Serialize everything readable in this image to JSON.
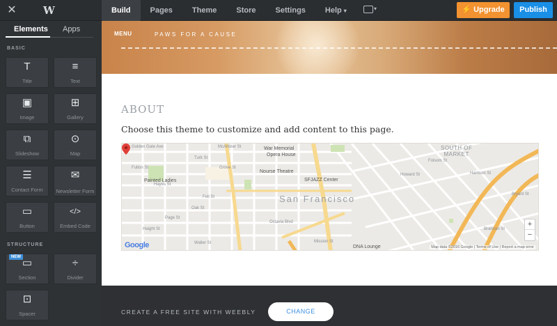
{
  "topbar": {
    "close_icon": "close-icon",
    "logo_icon": "W",
    "nav": [
      {
        "label": "Build",
        "active": true
      },
      {
        "label": "Pages"
      },
      {
        "label": "Theme"
      },
      {
        "label": "Store"
      },
      {
        "label": "Settings"
      },
      {
        "label": "Help",
        "dropdown": true
      }
    ],
    "upgrade_label": "Upgrade",
    "publish_label": "Publish",
    "colors": {
      "upgrade": "#f39230",
      "publish": "#1a8fe6"
    }
  },
  "sidebar": {
    "tabs": [
      {
        "label": "Elements",
        "active": true
      },
      {
        "label": "Apps"
      }
    ],
    "basic_label": "BASIC",
    "structure_label": "STRUCTURE",
    "basic_items": [
      {
        "label": "Title",
        "icon": "T",
        "icon_name": "title-icon"
      },
      {
        "label": "Text",
        "icon": "≡",
        "icon_name": "text-icon"
      },
      {
        "label": "Image",
        "icon": "▣",
        "icon_name": "image-icon"
      },
      {
        "label": "Gallery",
        "icon": "⊞",
        "icon_name": "gallery-icon"
      },
      {
        "label": "Slideshow",
        "icon": "⧉",
        "icon_name": "slideshow-icon"
      },
      {
        "label": "Map",
        "icon": "⊙",
        "icon_name": "map-pin-icon"
      },
      {
        "label": "Contact Form",
        "icon": "☰",
        "icon_name": "contact-form-icon"
      },
      {
        "label": "Newsletter Form",
        "icon": "✉",
        "icon_name": "envelope-icon"
      },
      {
        "label": "Button",
        "icon": "▭",
        "icon_name": "button-icon"
      },
      {
        "label": "Embed Code",
        "icon": "</>",
        "icon_name": "code-icon"
      }
    ],
    "structure_items": [
      {
        "label": "Section",
        "icon": "▭",
        "icon_name": "section-icon",
        "badge": "NEW"
      },
      {
        "label": "Divider",
        "icon": "÷",
        "icon_name": "divider-icon"
      },
      {
        "label": "Spacer",
        "icon": "⊡",
        "icon_name": "spacer-icon"
      }
    ]
  },
  "hero": {
    "menu_label": "MENU",
    "site_title": "PAWS FOR A CAUSE"
  },
  "content": {
    "heading": "ABOUT",
    "body": "Choose this theme to customize and add content to this page."
  },
  "map": {
    "city": "San Francisco",
    "neighborhood": "SOUTH OF\nMARKET",
    "pois": [
      "War Memorial",
      "Opera House",
      "Painted Ladies",
      "Nourse Theatre",
      "SFJAZZ Center",
      "DNA Lounge"
    ],
    "streets": [
      "Golden Gate Ave",
      "McAllister St",
      "Turk St",
      "Fulton St",
      "Grove St",
      "Hayes St",
      "Fell St",
      "Oak St",
      "Page St",
      "Haight St",
      "Waller St",
      "Octavia Blvd",
      "Mission St",
      "Howard St",
      "Folsom St",
      "Harrison St",
      "Bryant St",
      "Brannan St"
    ],
    "google_label": "Google",
    "footer_text": "Map data ©2016 Google  |  Terms of Use  |  Report a map error",
    "zoom_in": "+",
    "zoom_out": "−"
  },
  "footer": {
    "text": "CREATE A FREE SITE WITH WEEBLY",
    "button": "CHANGE"
  }
}
